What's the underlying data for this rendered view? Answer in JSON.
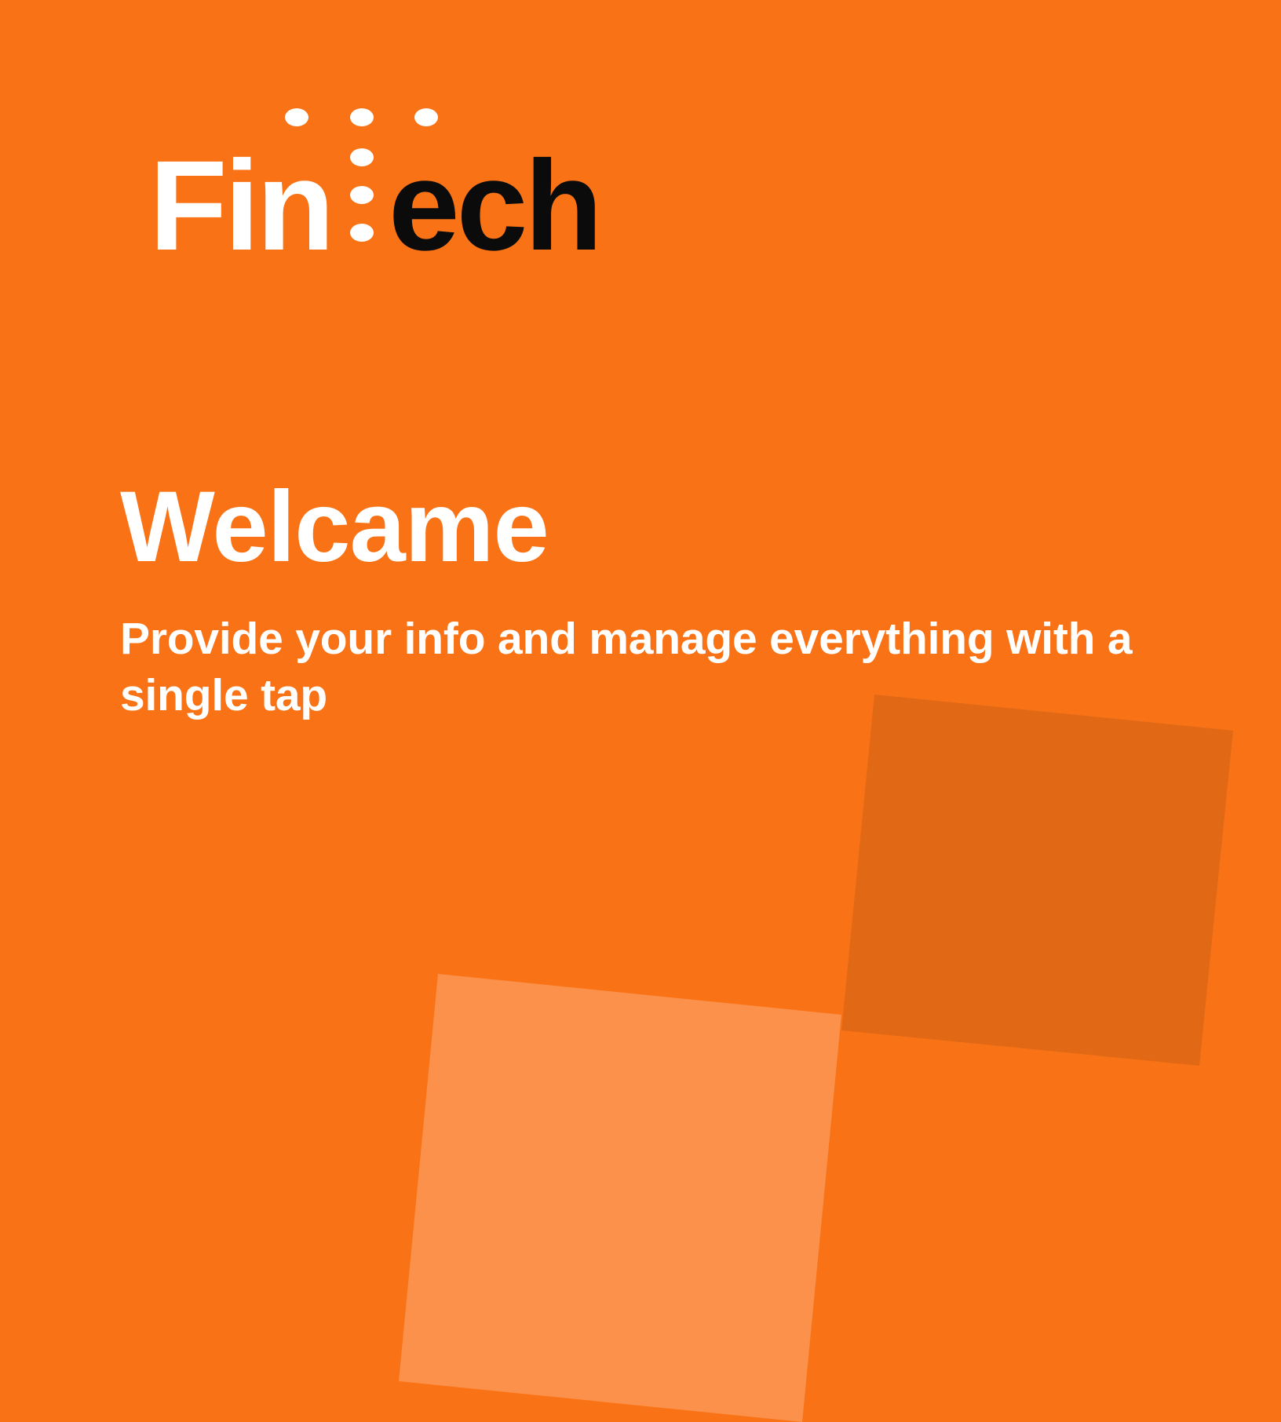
{
  "colors": {
    "background": "#f97316",
    "light_square": "#fb914a",
    "dark_square": "#e16915",
    "white": "#ffffff",
    "black": "#0b0b0b"
  },
  "logo": {
    "part_white": "Fin",
    "part_black": "ech"
  },
  "welcome": {
    "title": "Welcame",
    "subtitle": "Provide your info and manage everything with a single tap"
  }
}
